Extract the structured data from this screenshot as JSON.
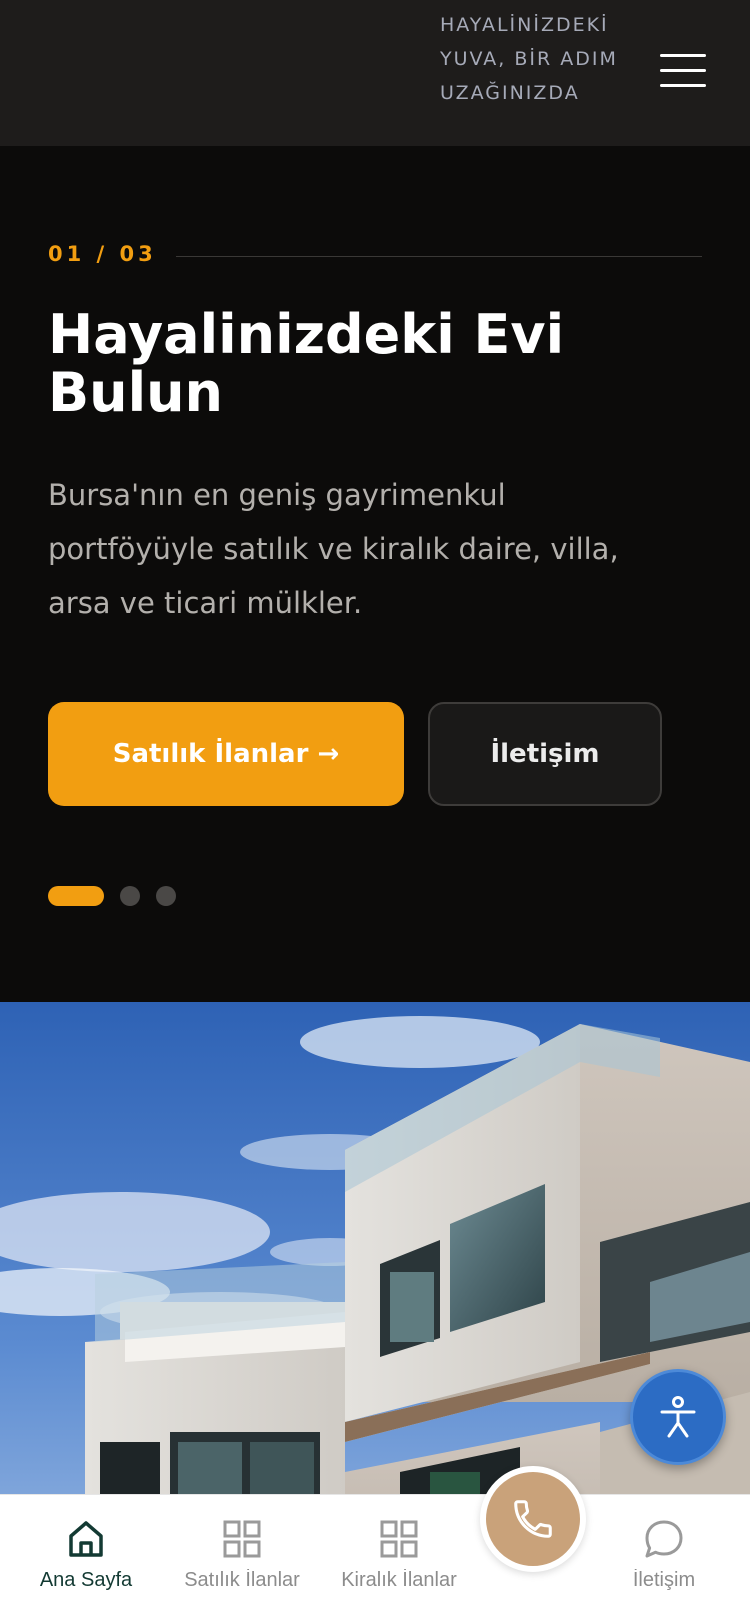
{
  "header": {
    "tagline": "HAYALİNİZDEKİ YUVA, BİR ADIM UZAĞINIZDA",
    "menu_icon": "hamburger-menu-icon"
  },
  "hero": {
    "slide_counter": "01 / 03",
    "title": "Hayalinizdeki Evi Bulun",
    "description": "Bursa'nın en geniş gayrimenkul portföyüyle satılık ve kiralık daire, villa, arsa ve ticari mülkler.",
    "primary_button": "Satılık İlanlar →",
    "secondary_button": "İletişim",
    "slides_total": 3,
    "active_slide": 1
  },
  "accessibility": {
    "icon": "accessibility-icon"
  },
  "call_button": {
    "icon": "phone-icon"
  },
  "bottom_nav": {
    "items": [
      {
        "label": "Ana Sayfa",
        "icon": "home-icon",
        "active": true
      },
      {
        "label": "Satılık İlanlar",
        "icon": "grid-icon",
        "active": false
      },
      {
        "label": "Kiralık İlanlar",
        "icon": "grid-icon",
        "active": false
      },
      {
        "label": "İletişim",
        "icon": "chat-bubble-icon",
        "active": false
      }
    ]
  },
  "colors": {
    "accent": "#f29e11",
    "header_bg": "#1e1c1b",
    "hero_bg": "#0c0b0a",
    "nav_active": "#133a33",
    "call_button": "#c9a27a",
    "accessibility_button": "#2c6cc4"
  }
}
